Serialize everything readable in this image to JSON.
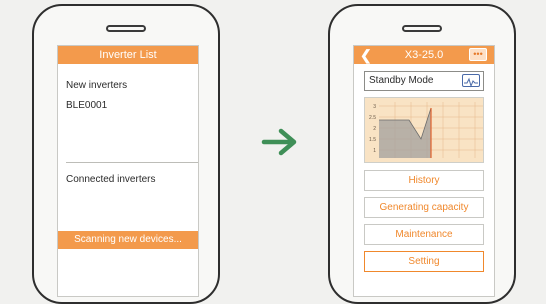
{
  "left_screen": {
    "title": "Inverter List",
    "new_inverters_label": "New inverters",
    "device": "BLE0001",
    "connected_label": "Connected inverters",
    "scan_label": "Scanning new devices..."
  },
  "right_screen": {
    "title": "X3-25.0",
    "back_icon": "chevron-left-icon",
    "more_icon": "more-dots-icon",
    "status": "Standby Mode",
    "status_icon": "waveform-icon",
    "chart_y_ticks": [
      "3",
      "2.5",
      "2",
      "1.5",
      "1"
    ],
    "menu": [
      "History",
      "Generating capacity",
      "Maintenance",
      "Setting"
    ],
    "selected_menu": "Setting"
  },
  "arrow_icon": "right-arrow-icon",
  "colors": {
    "accent": "#f39a4c",
    "menu_text": "#f0882c",
    "arrow": "#3f8f57",
    "chart_bg": "#f9e3c4"
  }
}
